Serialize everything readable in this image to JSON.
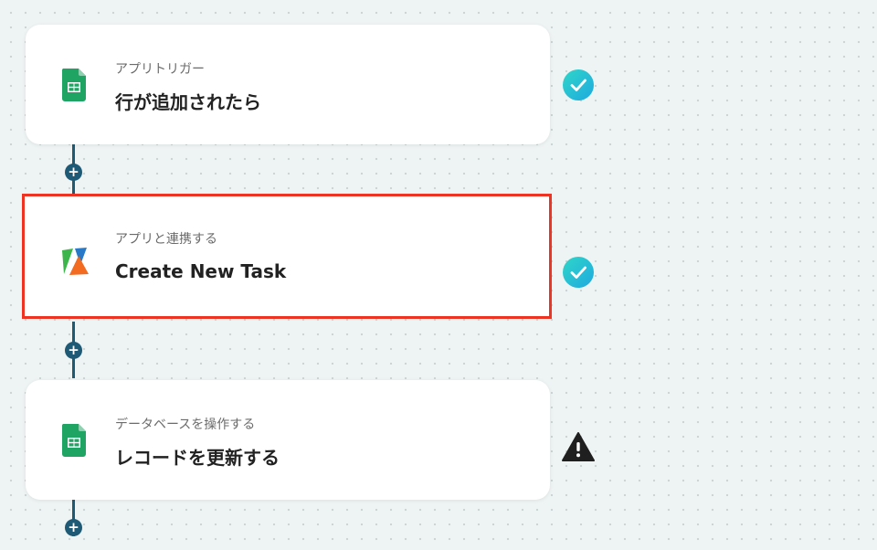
{
  "steps": [
    {
      "type_label": "アプリトリガー",
      "title": "行が追加されたら",
      "app_icon": "google-sheets-icon",
      "status": "complete"
    },
    {
      "type_label": "アプリと連携する",
      "title": "Create New Task",
      "app_icon": "app-logo-icon",
      "status": "complete"
    },
    {
      "type_label": "データベースを操作する",
      "title": "レコードを更新する",
      "app_icon": "google-sheets-icon",
      "status": "warning"
    }
  ],
  "add_step_symbol": "+",
  "colors": {
    "connector": "#1e5a76",
    "check": "#26c6da",
    "selected_border": "#ee3322",
    "sheets_green": "#1fa463"
  }
}
